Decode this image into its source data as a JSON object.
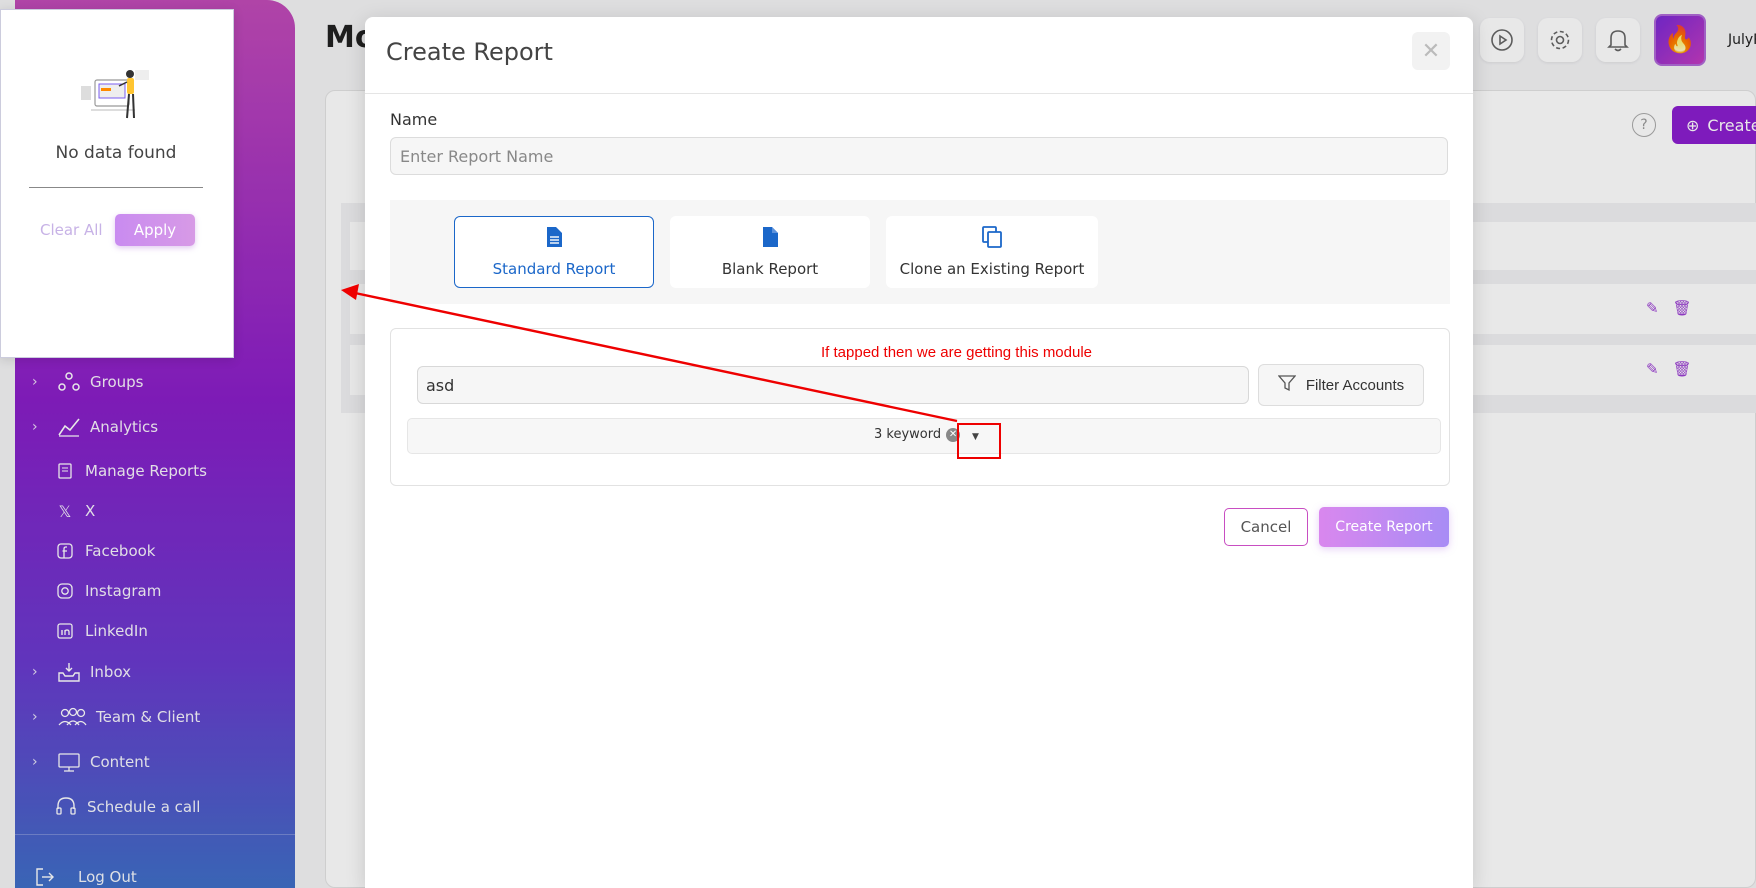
{
  "background": {
    "page_title": "Mo",
    "username": "JulyP",
    "create_button": "Create",
    "sidebar": {
      "items": [
        {
          "label": "Groups",
          "icon": "groups-icon",
          "expandable": true
        },
        {
          "label": "Analytics",
          "icon": "analytics-icon",
          "expandable": true
        },
        {
          "label": "Manage Reports",
          "icon": "report-icon",
          "expandable": false
        },
        {
          "label": "X",
          "icon": "x-icon",
          "expandable": false
        },
        {
          "label": "Facebook",
          "icon": "facebook-icon",
          "expandable": false
        },
        {
          "label": "Instagram",
          "icon": "instagram-icon",
          "expandable": false
        },
        {
          "label": "LinkedIn",
          "icon": "linkedin-icon",
          "expandable": false
        },
        {
          "label": "Inbox",
          "icon": "inbox-icon",
          "expandable": true
        },
        {
          "label": "Team & Client",
          "icon": "team-icon",
          "expandable": true
        },
        {
          "label": "Content",
          "icon": "content-icon",
          "expandable": true
        },
        {
          "label": "Schedule a call",
          "icon": "headset-icon",
          "expandable": false
        }
      ],
      "logout": "Log Out"
    }
  },
  "filter_popup": {
    "empty_text": "No data found",
    "clear_label": "Clear All",
    "apply_label": "Apply"
  },
  "modal": {
    "title": "Create Report",
    "name_label": "Name",
    "name_placeholder": "Enter Report Name",
    "report_types": [
      {
        "label": "Standard Report",
        "icon": "document-icon",
        "active": true
      },
      {
        "label": "Blank Report",
        "icon": "blank-document-icon",
        "active": false
      },
      {
        "label": "Clone an Existing Report",
        "icon": "copy-icon",
        "active": false
      }
    ],
    "annotation": "If tapped then we are getting this module",
    "search_value": "asd",
    "filter_accounts_label": "Filter Accounts",
    "keyword_chip": "3 keyword",
    "cancel_label": "Cancel",
    "create_label": "Create Report"
  },
  "colors": {
    "accent": "#8b1ecf",
    "link_blue": "#1b67c9",
    "annotation_red": "#e00000"
  }
}
